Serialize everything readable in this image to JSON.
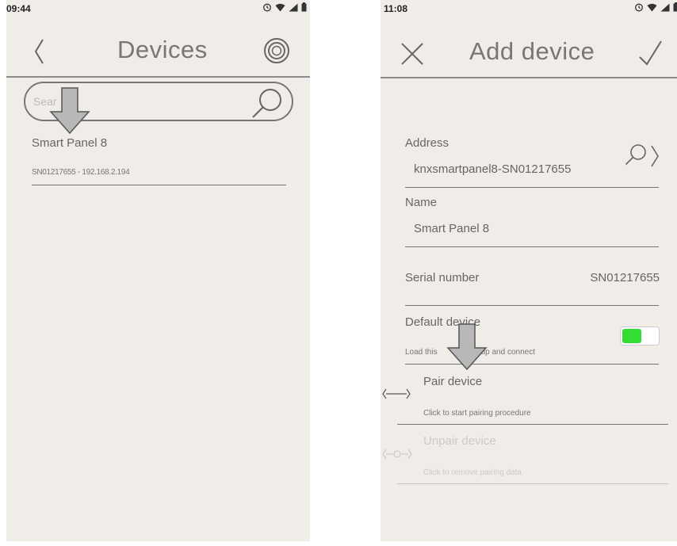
{
  "left": {
    "status": {
      "time": "09:44",
      "icons": [
        "alarm-icon",
        "wifi-icon",
        "signal-icon",
        "battery-icon"
      ]
    },
    "header": {
      "title": "Devices",
      "back_icon": "chevron-left-icon",
      "action_icon": "discover-icon"
    },
    "search": {
      "placeholder": "Sear"
    },
    "devices": [
      {
        "name": "Smart Panel 8",
        "detail": "SN01217655 - 192.168.2.194"
      }
    ]
  },
  "right": {
    "status": {
      "time": "11:08",
      "icons": [
        "alarm-icon",
        "wifi-icon",
        "signal-icon",
        "battery-icon"
      ]
    },
    "header": {
      "title": "Add device",
      "close_icon": "close-icon",
      "confirm_icon": "check-icon"
    },
    "address": {
      "label": "Address",
      "value": "knxsmartpanel8-SN01217655"
    },
    "name": {
      "label": "Name",
      "value": "Smart Panel 8"
    },
    "serial": {
      "label": "Serial number",
      "value": "SN01217655"
    },
    "default_device": {
      "label": "Default device",
      "description": "Load this",
      "description_tail": "t startup and connect",
      "enabled": true,
      "toggle_color": "#33dd33"
    },
    "pair": {
      "label": "Pair device",
      "description": "Click to start pairing procedure"
    },
    "unpair": {
      "label": "Unpair device",
      "description": "Click to remove pairing data"
    }
  }
}
